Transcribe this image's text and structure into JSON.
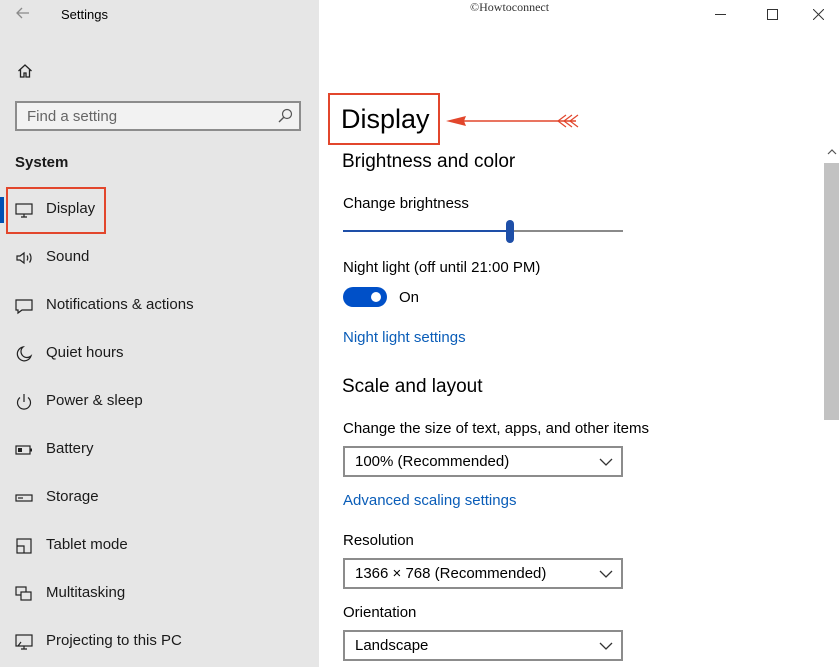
{
  "window": {
    "title": "Settings",
    "watermark": "©Howtoconnect"
  },
  "sidebar": {
    "search_placeholder": "Find a setting",
    "section_label": "System",
    "items": [
      {
        "label": "Display",
        "icon": "monitor-icon",
        "active": true
      },
      {
        "label": "Sound",
        "icon": "speaker-icon"
      },
      {
        "label": "Notifications & actions",
        "icon": "notification-icon"
      },
      {
        "label": "Quiet hours",
        "icon": "moon-icon"
      },
      {
        "label": "Power & sleep",
        "icon": "power-icon"
      },
      {
        "label": "Battery",
        "icon": "battery-icon"
      },
      {
        "label": "Storage",
        "icon": "storage-icon"
      },
      {
        "label": "Tablet mode",
        "icon": "tablet-icon"
      },
      {
        "label": "Multitasking",
        "icon": "multitasking-icon"
      },
      {
        "label": "Projecting to this PC",
        "icon": "projecting-icon"
      }
    ]
  },
  "main": {
    "page_title": "Display",
    "brightness_section": {
      "heading": "Brightness and color",
      "slider_label": "Change brightness",
      "brightness_value": 0.6,
      "night_light_label": "Night light (off until 21:00 PM)",
      "toggle_state": "On",
      "night_light_link": "Night light settings"
    },
    "scale_section": {
      "heading": "Scale and layout",
      "size_label": "Change the size of text, apps, and other items",
      "size_value": "100% (Recommended)",
      "advanced_link": "Advanced scaling settings",
      "resolution_label": "Resolution",
      "resolution_value": "1366 × 768 (Recommended)",
      "orientation_label": "Orientation",
      "orientation_value": "Landscape"
    }
  },
  "colors": {
    "accent": "#0050c8",
    "link": "#0a5db8",
    "annotation": "#e2462c",
    "sidebar_bg": "#e6e6e6"
  }
}
